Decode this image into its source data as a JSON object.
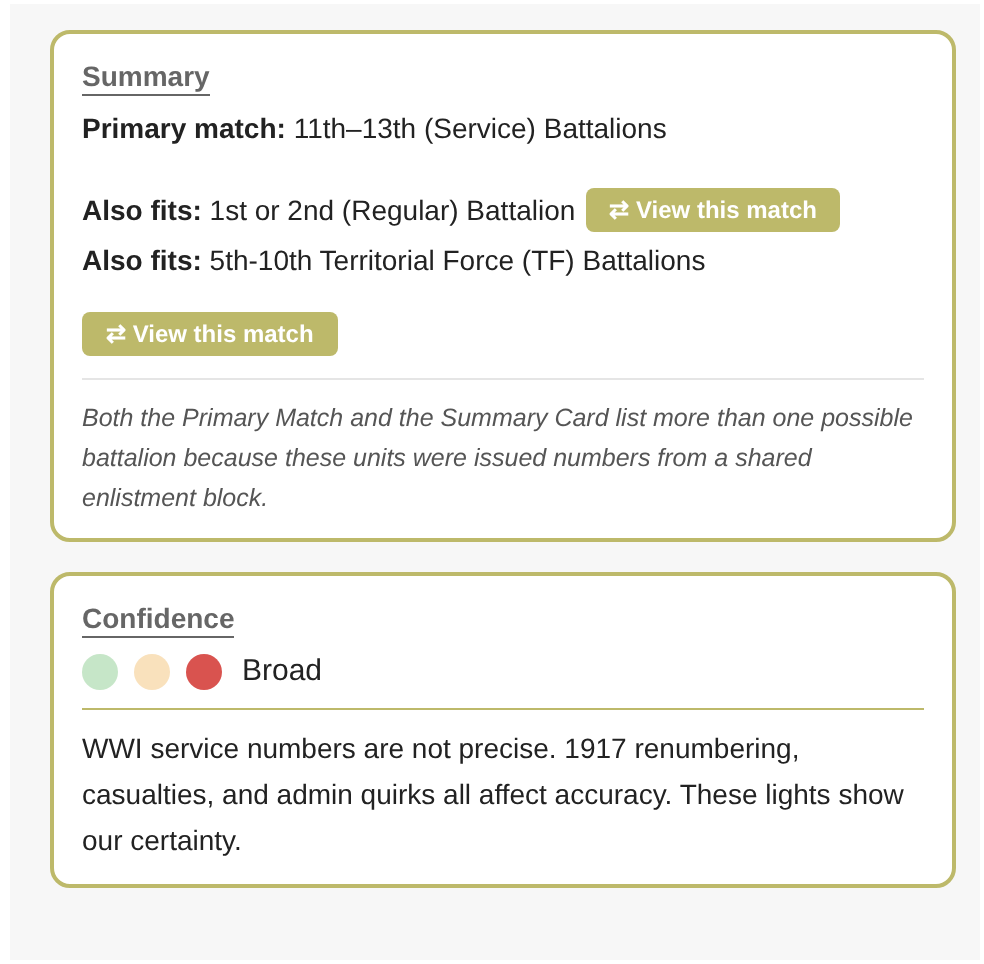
{
  "summary": {
    "title": "Summary",
    "primary": {
      "label": "Primary match:",
      "value": "11th–13th (Service) Battalions"
    },
    "also_fits": [
      {
        "label": "Also fits:",
        "value": "1st or 2nd (Regular) Battalion",
        "button": "⇄ View this match",
        "button_inline": true
      },
      {
        "label": "Also fits:",
        "value": "5th-10th Territorial Force (TF) Battalions",
        "button": "⇄ View this match",
        "button_inline": false
      }
    ],
    "note": "Both the Primary Match and the Summary Card list more than one possible battalion because these units were issued numbers from a shared enlistment block."
  },
  "confidence": {
    "title": "Confidence",
    "lights": [
      {
        "color": "#c6e6c8"
      },
      {
        "color": "#f9e1bc"
      },
      {
        "color": "#d9534f"
      }
    ],
    "level_label": "Broad",
    "text": "WWI service numbers are not precise. 1917 renumbering, casualties, and admin quirks all affect accuracy. These lights show our certainty."
  }
}
